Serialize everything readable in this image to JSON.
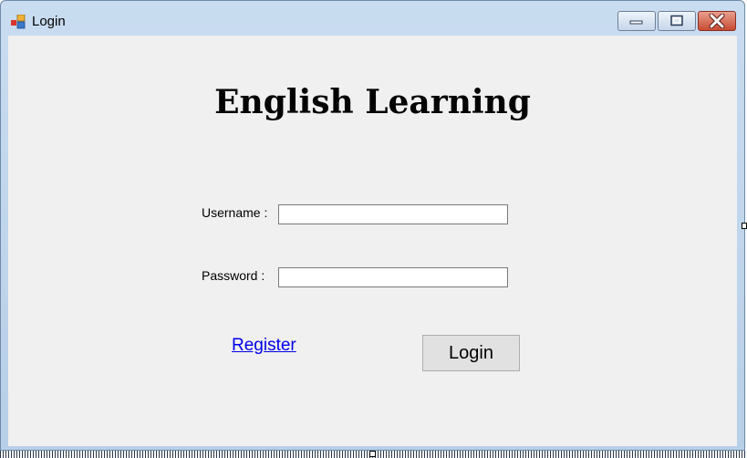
{
  "window": {
    "title": "Login",
    "icon": "app-icon",
    "controls": {
      "minimize": "minimize-icon",
      "maximize": "maximize-icon",
      "close": "close-icon"
    },
    "close_color": "#c74b33"
  },
  "form": {
    "heading": "English Learning",
    "username_label": "Username :",
    "username_value": "",
    "password_label": "Password :",
    "password_value": "",
    "register_link": "Register",
    "login_button": "Login"
  },
  "colors": {
    "link": "#0000ee",
    "client_bg": "#f0f0f0",
    "button_bg": "#e1e1e1"
  }
}
